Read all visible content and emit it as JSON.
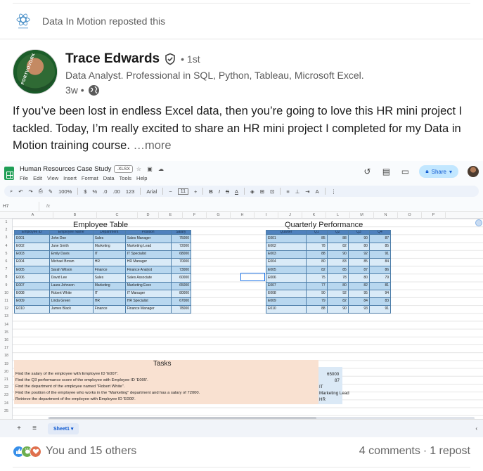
{
  "repost": {
    "source": "Data In Motion",
    "text_suffix": "reposted this"
  },
  "author": {
    "name": "Trace Edwards",
    "degree": "• 1st",
    "headline": "Data Analyst. Professional in SQL, Python, Tableau, Microsoft Excel.",
    "time": "3w •",
    "avatar_caption": "PORTVOVORK"
  },
  "post": {
    "text": "If you’ve been lost in endless Excel data, then you’re going to love this HR mini project I tackled. Today, I’m really excited to share an HR mini project I completed for my Data in Motion training course.",
    "more_label": "…more"
  },
  "spreadsheet": {
    "doc_title": "Human Resources Case Study",
    "badge": ".XLSX",
    "menu": [
      "File",
      "Edit",
      "View",
      "Insert",
      "Format",
      "Data",
      "Tools",
      "Help"
    ],
    "share_label": "Share",
    "zoom": "100%",
    "currency": "$",
    "percent": "%",
    "decimal_less": ".0",
    "decimal_more": ".00",
    "number_format": "123",
    "font": "Arial",
    "font_size": "11",
    "name_box": "H7",
    "fx_label": "fx",
    "columns": [
      "A",
      "B",
      "C",
      "D",
      "E",
      "F",
      "G",
      "H",
      "I",
      "J",
      "K",
      "L",
      "M",
      "N",
      "O",
      "P"
    ],
    "rows": [
      "1",
      "2",
      "3",
      "4",
      "5",
      "6",
      "7",
      "8",
      "9",
      "10",
      "11",
      "12",
      "13",
      "14",
      "15",
      "16",
      "17",
      "18",
      "19",
      "20",
      "21",
      "22",
      "23",
      "24",
      "25"
    ],
    "employee_table": {
      "title": "Employee Table",
      "headers": [
        "Employee ID",
        "Employee Name",
        "Department",
        "Position",
        "Salary"
      ],
      "rows": [
        [
          "E001",
          "John Doe",
          "Sales",
          "Sales Manager",
          "75000"
        ],
        [
          "E002",
          "Jane Smith",
          "Marketing",
          "Marketing Lead",
          "72000"
        ],
        [
          "E003",
          "Emily Davis",
          "IT",
          "IT Specialist",
          "68000"
        ],
        [
          "E004",
          "Michael Brown",
          "HR",
          "HR Manager",
          "70000"
        ],
        [
          "E005",
          "Sarah Wilson",
          "Finance",
          "Finance Analyst",
          "73000"
        ],
        [
          "E006",
          "David Lee",
          "Sales",
          "Sales Associate",
          "60000"
        ],
        [
          "E007",
          "Laura Johnson",
          "Marketing",
          "Marketing Exec",
          "65000"
        ],
        [
          "E008",
          "Robert White",
          "IT",
          "IT Manager",
          "80000"
        ],
        [
          "E009",
          "Linda Green",
          "HR",
          "HR Specialist",
          "67000"
        ],
        [
          "E010",
          "James Black",
          "Finance",
          "Finance Manager",
          "78000"
        ]
      ]
    },
    "quarterly_table": {
      "title": "Quarterly Performance",
      "headers": [
        "Quarter",
        "Q1",
        "Q2",
        "Q3",
        "Q4"
      ],
      "rows": [
        [
          "E001",
          "85",
          "88",
          "90",
          "87"
        ],
        [
          "E002",
          "78",
          "82",
          "80",
          "85"
        ],
        [
          "E003",
          "88",
          "90",
          "92",
          "91"
        ],
        [
          "E004",
          "80",
          "83",
          "85",
          "84"
        ],
        [
          "E005",
          "82",
          "85",
          "87",
          "86"
        ],
        [
          "E006",
          "75",
          "78",
          "80",
          "79"
        ],
        [
          "E007",
          "77",
          "80",
          "82",
          "81"
        ],
        [
          "E008",
          "90",
          "92",
          "95",
          "94"
        ],
        [
          "E009",
          "79",
          "82",
          "84",
          "83"
        ],
        [
          "E010",
          "88",
          "90",
          "93",
          "91"
        ]
      ]
    },
    "tasks": {
      "title": "Tasks",
      "items": [
        {
          "q": "Find the salary of the employee with Employee ID 'E007'.",
          "a": "65000"
        },
        {
          "q": "Find the Q3 performance score of the employee with Employee ID 'E005'.",
          "a": "87"
        },
        {
          "q": "Find the department of the employee named \"Robert White\".",
          "a": "IT"
        },
        {
          "q": "Find the position of the employee who works in the \"Marketing\" department and has a salary of 72000.",
          "a": "Marketing Lead"
        },
        {
          "q": "Retrieve the department of the employee with Employee ID 'E009'.",
          "a": "HR"
        }
      ]
    },
    "sheet_tab": "Sheet1"
  },
  "footer": {
    "reactions_text": "You and 15 others",
    "comments": "4 comments",
    "separator": "·",
    "reposts": "1 repost"
  },
  "colors": {
    "table_header": "#4f81bd",
    "table_row": "#b8d7ef",
    "tasks_bg": "#f9e1d1",
    "share_bg": "#c2e7ff",
    "sheets_green": "#1e9e56"
  }
}
